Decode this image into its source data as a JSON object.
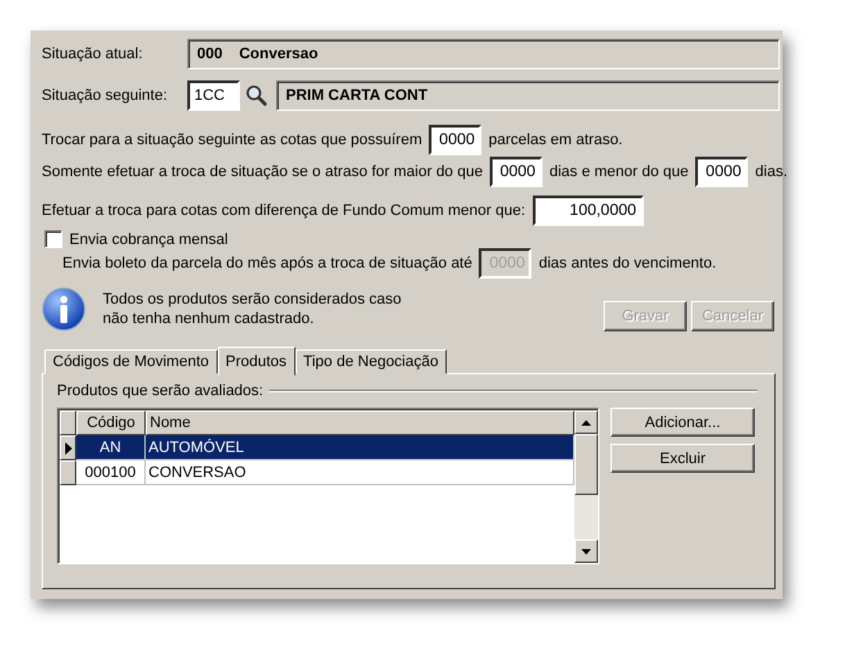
{
  "current_situation": {
    "label": "Situação atual:",
    "code": "000",
    "name": "Conversao"
  },
  "next_situation": {
    "label": "Situação seguinte:",
    "code": "1CC",
    "name": "PRIM CARTA CONT"
  },
  "rules": [
    {
      "parts": [
        {
          "kind": "text",
          "text": "Trocar para a situação seguinte as cotas que possuírem"
        },
        {
          "kind": "input",
          "value": "0000"
        },
        {
          "kind": "text",
          "text": "parcelas em atraso."
        }
      ]
    },
    {
      "parts": [
        {
          "kind": "text",
          "text": "Somente efetuar a troca de situação se o atraso for maior do que"
        },
        {
          "kind": "input",
          "value": "0000"
        },
        {
          "kind": "text",
          "text": "dias e menor do que"
        },
        {
          "kind": "input",
          "value": "0000"
        },
        {
          "kind": "text",
          "text": "dias."
        }
      ]
    },
    {
      "parts": [
        {
          "kind": "text",
          "text": "Efetuar a troca para cotas com diferença de Fundo Comum menor que:"
        },
        {
          "kind": "input",
          "value": "100,0000"
        }
      ]
    }
  ],
  "monthly_billing": {
    "label": "Envia cobrança mensal",
    "checked": false,
    "detail": {
      "disabled": true,
      "parts": [
        {
          "kind": "text",
          "text": "Envia boleto da parcela do mês após a troca de situação até"
        },
        {
          "kind": "input",
          "value": "0000"
        },
        {
          "kind": "text",
          "text": "dias antes do vencimento."
        }
      ]
    }
  },
  "info": {
    "text": "Todos os produtos serão considerados caso não tenha nenhum cadastrado."
  },
  "actions": [
    {
      "label": "Gravar",
      "disabled": true
    },
    {
      "label": "Cancelar",
      "disabled": true
    }
  ],
  "tabs": [
    {
      "label": "Códigos de Movimento",
      "selected": false
    },
    {
      "label": "Produtos",
      "selected": true
    },
    {
      "label": "Tipo de Negociação",
      "selected": false
    }
  ],
  "products": {
    "group_label": "Produtos que serão avaliados:",
    "columns": [
      "Código",
      "Nome"
    ],
    "rows": [
      {
        "cells": [
          "AN",
          "AUTOMÓVEL"
        ],
        "selected": true
      },
      {
        "cells": [
          "000100",
          "CONVERSAO"
        ],
        "selected": false
      }
    ],
    "buttons": [
      {
        "label": "Adicionar...",
        "disabled": false
      },
      {
        "label": "Excluir",
        "disabled": false
      }
    ]
  }
}
